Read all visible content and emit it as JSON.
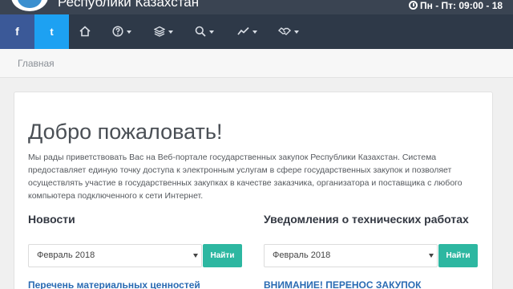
{
  "header": {
    "portal_title": "Республики Казахстан",
    "hours": "Пн - Пт: 09:00 - 18"
  },
  "nav": {
    "facebook": "f",
    "twitter": "t"
  },
  "breadcrumb": {
    "home": "Главная"
  },
  "main": {
    "welcome": "Добро пожаловать!",
    "intro": "Мы рады приветствовать Вас на Веб-портале государственных закупок Республики Казахстан. Система предоставляет единую точку доступа к электронным услугам в сфере государственных закупок и позволяет осуществлять участие в государственных закупках в качестве заказчика, организатора и поставщика с любого компьютера подключенного к сети Интернет."
  },
  "news": {
    "title": "Новости",
    "select_value": "Февраль 2018",
    "button": "Найти",
    "first_link": "Перечень материальных ценностей"
  },
  "maintenance": {
    "title": "Уведомления о технических работах",
    "select_value": "Февраль 2018",
    "button": "Найти",
    "first_link": "ВНИМАНИЕ! ПЕРЕНОС ЗАКУПОК"
  },
  "colors": {
    "navbar": "#2e3948",
    "facebook": "#3b5998",
    "twitter": "#1da1f2",
    "accent_button": "#2db7a1",
    "link": "#2a6bb3"
  }
}
